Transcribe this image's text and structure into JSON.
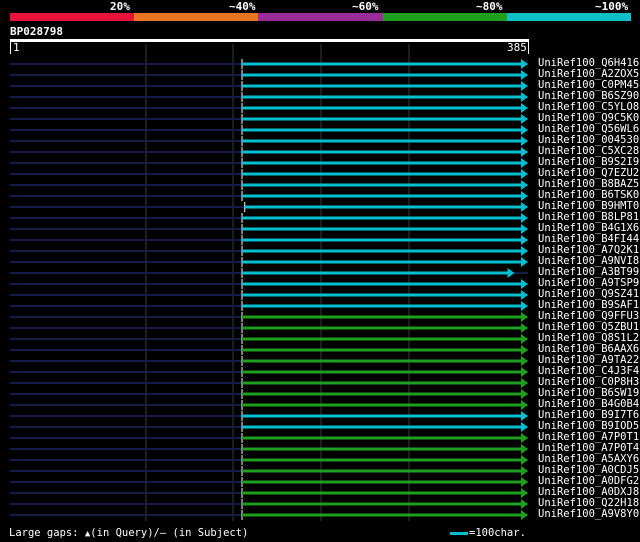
{
  "scale": {
    "labels": [
      "20%",
      "~40%",
      "~60%",
      "~80%",
      "~100%"
    ],
    "colors": [
      "#e8123a",
      "#e87520",
      "#9a2c9a",
      "#1ea01e",
      "#10c0c8"
    ]
  },
  "query": {
    "id": "BP028798",
    "start": "1",
    "end": "385",
    "length": 385
  },
  "hits": [
    {
      "id": "UniRef100_Q6H416",
      "color": "#00c0d0",
      "qstart": 173,
      "qend": 385
    },
    {
      "id": "UniRef100_A2ZOX5",
      "color": "#00c0d0",
      "qstart": 173,
      "qend": 385
    },
    {
      "id": "UniRef100_C0PM45",
      "color": "#00c0d0",
      "qstart": 173,
      "qend": 385
    },
    {
      "id": "UniRef100_B6SZ90",
      "color": "#00c0d0",
      "qstart": 173,
      "qend": 385
    },
    {
      "id": "UniRef100_C5YLO8",
      "color": "#00c0d0",
      "qstart": 173,
      "qend": 385
    },
    {
      "id": "UniRef100_Q9C5K0",
      "color": "#00c0d0",
      "qstart": 173,
      "qend": 385
    },
    {
      "id": "UniRef100_Q56WL6",
      "color": "#00c0d0",
      "qstart": 173,
      "qend": 385
    },
    {
      "id": "UniRef100_004530",
      "color": "#00c0d0",
      "qstart": 173,
      "qend": 385
    },
    {
      "id": "UniRef100_C5XC28",
      "color": "#00c0d0",
      "qstart": 173,
      "qend": 385
    },
    {
      "id": "UniRef100_B9S2I9",
      "color": "#00c0d0",
      "qstart": 173,
      "qend": 385
    },
    {
      "id": "UniRef100_Q7EZU2",
      "color": "#00c0d0",
      "qstart": 173,
      "qend": 385
    },
    {
      "id": "UniRef100_B8BAZ5",
      "color": "#00c0d0",
      "qstart": 173,
      "qend": 385
    },
    {
      "id": "UniRef100_B6TSK0",
      "color": "#00c0d0",
      "qstart": 173,
      "qend": 385
    },
    {
      "id": "UniRef100_B9HMT0",
      "color": "#00c0d0",
      "qstart": 175,
      "qend": 385
    },
    {
      "id": "UniRef100_B8LP81",
      "color": "#00c0d0",
      "qstart": 173,
      "qend": 385
    },
    {
      "id": "UniRef100_B4G1X6",
      "color": "#00c0d0",
      "qstart": 173,
      "qend": 385
    },
    {
      "id": "UniRef100_B4FI44",
      "color": "#00c0d0",
      "qstart": 173,
      "qend": 385
    },
    {
      "id": "UniRef100_A7Q2K1",
      "color": "#00c0d0",
      "qstart": 173,
      "qend": 385
    },
    {
      "id": "UniRef100_A9NVI8",
      "color": "#00c0d0",
      "qstart": 173,
      "qend": 385
    },
    {
      "id": "UniRef100_A3BT99",
      "color": "#00c0d0",
      "qstart": 173,
      "qend": 375
    },
    {
      "id": "UniRef100_A9TSP9",
      "color": "#00c0d0",
      "qstart": 173,
      "qend": 385
    },
    {
      "id": "UniRef100_Q9SZ41",
      "color": "#00c0d0",
      "qstart": 173,
      "qend": 385
    },
    {
      "id": "UniRef100_B9SAF1",
      "color": "#00c0d0",
      "qstart": 173,
      "qend": 385
    },
    {
      "id": "UniRef100_Q9FFU3",
      "color": "#1ea01e",
      "qstart": 173,
      "qend": 385
    },
    {
      "id": "UniRef100_Q5ZBU1",
      "color": "#1ea01e",
      "qstart": 173,
      "qend": 385
    },
    {
      "id": "UniRef100_Q8S1L2",
      "color": "#1ea01e",
      "qstart": 173,
      "qend": 385
    },
    {
      "id": "UniRef100_B6AAX6",
      "color": "#1ea01e",
      "qstart": 173,
      "qend": 385
    },
    {
      "id": "UniRef100_A9TA22",
      "color": "#1ea01e",
      "qstart": 173,
      "qend": 385
    },
    {
      "id": "UniRef100_C4J3F4",
      "color": "#1ea01e",
      "qstart": 173,
      "qend": 385
    },
    {
      "id": "UniRef100_C0P8H3",
      "color": "#1ea01e",
      "qstart": 173,
      "qend": 385
    },
    {
      "id": "UniRef100_B6SW19",
      "color": "#1ea01e",
      "qstart": 173,
      "qend": 385
    },
    {
      "id": "UniRef100_B4G0B4",
      "color": "#1ea01e",
      "qstart": 173,
      "qend": 385
    },
    {
      "id": "UniRef100_B9I7T6",
      "color": "#00c0d0",
      "qstart": 173,
      "qend": 385
    },
    {
      "id": "UniRef100_B9IOD5",
      "color": "#00c0d0",
      "qstart": 173,
      "qend": 385
    },
    {
      "id": "UniRef100_A7P0T1",
      "color": "#1ea01e",
      "qstart": 173,
      "qend": 385
    },
    {
      "id": "UniRef100_A7P0T4",
      "color": "#1ea01e",
      "qstart": 173,
      "qend": 385
    },
    {
      "id": "UniRef100_A5AXY6",
      "color": "#1ea01e",
      "qstart": 173,
      "qend": 385
    },
    {
      "id": "UniRef100_A0CDJ5",
      "color": "#1ea01e",
      "qstart": 173,
      "qend": 385
    },
    {
      "id": "UniRef100_A0DFG2",
      "color": "#1ea01e",
      "qstart": 173,
      "qend": 385
    },
    {
      "id": "UniRef100_A0DXJ8",
      "color": "#1ea01e",
      "qstart": 173,
      "qend": 385
    },
    {
      "id": "UniRef100_Q22H18",
      "color": "#1ea01e",
      "qstart": 173,
      "qend": 385
    },
    {
      "id": "UniRef100_A9V8Y0",
      "color": "#1ea01e",
      "qstart": 173,
      "qend": 385
    }
  ],
  "footer": {
    "gaps_prefix": "Large gaps:",
    "tri_symbol": "▲",
    "in_query": "(in Query)/",
    "dash_symbol": "–",
    "in_subject": " (in Subject)",
    "scale_label": "=100char."
  }
}
